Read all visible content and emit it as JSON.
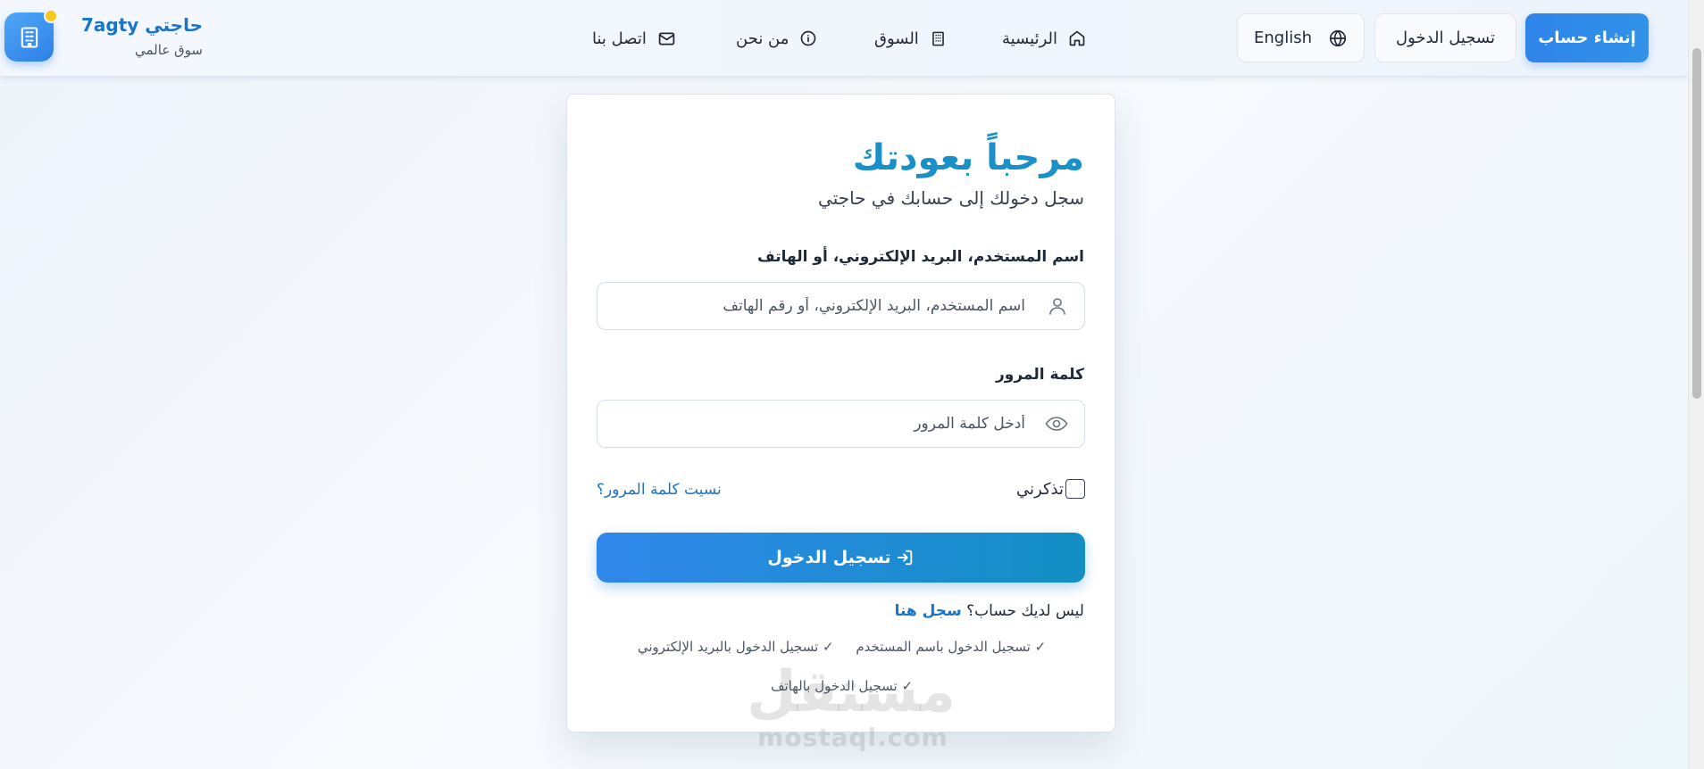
{
  "header": {
    "brand_name": "حاجتي 7agty",
    "brand_tagline": "سوق عالمي",
    "nav": [
      {
        "label": "الرئيسية",
        "icon": "home-icon"
      },
      {
        "label": "السوق",
        "icon": "building-icon"
      },
      {
        "label": "من نحن",
        "icon": "info-icon"
      },
      {
        "label": "اتصل بنا",
        "icon": "mail-icon"
      }
    ],
    "language_label": "English",
    "login_label": "تسجيل الدخول",
    "signup_label": "إنشاء حساب"
  },
  "card": {
    "title": "مرحباً بعودتك",
    "subtitle": "سجل دخولك إلى حسابك في حاجتي",
    "identifier": {
      "label": "اسم المستخدم، البريد الإلكتروني، أو الهاتف",
      "placeholder": "اسم المستخدم، البريد الإلكتروني، أو رقم الهاتف",
      "value": ""
    },
    "password": {
      "label": "كلمة المرور",
      "placeholder": "أدخل كلمة المرور",
      "value": ""
    },
    "remember_label": "تذكرني",
    "forgot_label": "نسيت كلمة المرور؟",
    "submit_label": "تسجيل الدخول",
    "no_account_text": "ليس لديك حساب؟",
    "register_link": "سجل هنا",
    "login_methods": [
      "✓ تسجيل الدخول باسم المستخدم",
      "✓ تسجيل الدخول بالبريد الإلكتروني",
      "✓ تسجيل الدخول بالهاتف"
    ]
  },
  "watermark": {
    "arabic": "مستقل",
    "url": "mostaql.com"
  },
  "colors": {
    "accent_blue": "#2f84ea",
    "title_blue": "#1b8fc8",
    "link_blue": "#1a74c9",
    "brand_dot": "#f8c91c"
  }
}
